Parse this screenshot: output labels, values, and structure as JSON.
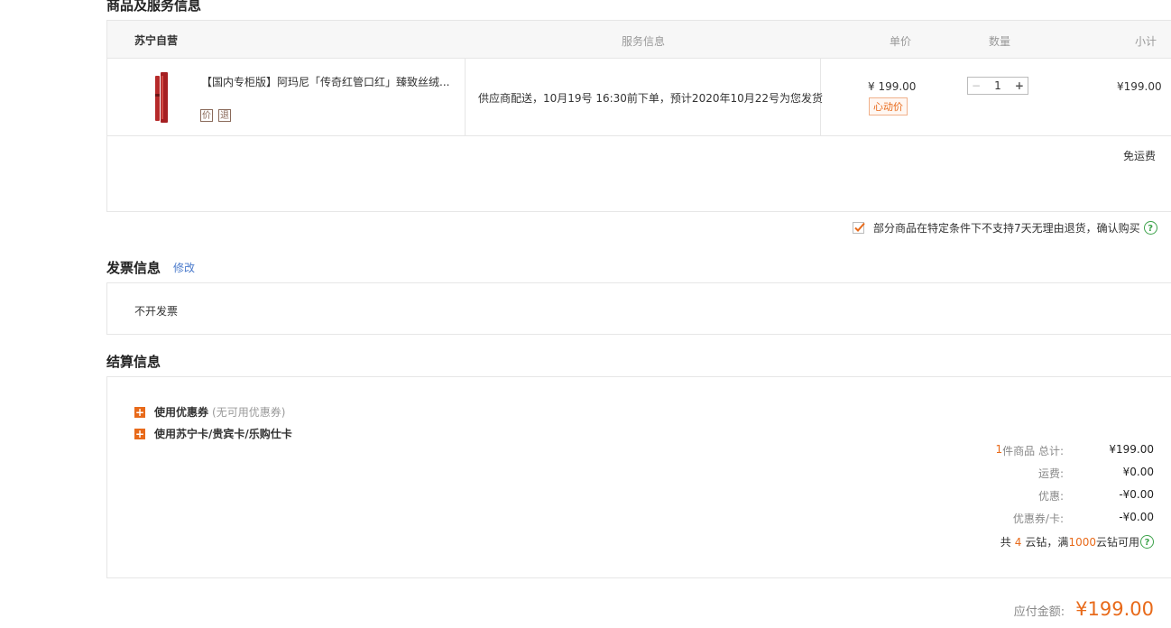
{
  "goods_section": {
    "title": "商品及服务信息",
    "header": {
      "store": "苏宁自营",
      "service": "服务信息",
      "unit_price": "单价",
      "quantity": "数量",
      "subtotal": "小计"
    },
    "item": {
      "name": "【国内专柜版】阿玛尼「传奇红管口红」臻致丝绒...",
      "badge1": "价",
      "badge2": "退",
      "service_text": "供应商配送，10月19号 16:30前下单，预计2020年10月22号为您发货",
      "unit_price": "¥ 199.00",
      "price_tag": "心动价",
      "qty_minus": "−",
      "qty_value": "1",
      "qty_plus": "+",
      "subtotal": "¥199.00"
    },
    "shipping": "免运费",
    "return_notice": "部分商品在特定条件下不支持7天无理由退货，确认购买",
    "help_glyph": "?"
  },
  "invoice_section": {
    "title": "发票信息",
    "edit_link": "修改",
    "value": "不开发票"
  },
  "settlement_section": {
    "title": "结算信息",
    "coupon_label": "使用优惠券",
    "coupon_note": "(无可用优惠券)",
    "card_label": "使用苏宁卡/贵宾卡/乐购仕卡",
    "plus_glyph": "+",
    "count": "1",
    "count_label": "件商品 总计:",
    "total": "¥199.00",
    "freight_label": "运费:",
    "freight": "¥0.00",
    "discount_label": "优惠:",
    "discount": "-¥0.00",
    "coupon_card_label": "优惠券/卡:",
    "coupon_card": "-¥0.00",
    "diamond_prefix": "共",
    "diamond_count": "4",
    "diamond_mid": "云钻，满",
    "diamond_threshold": "1000",
    "diamond_suffix": "云钻可用"
  },
  "payable": {
    "label": "应付金额:",
    "amount": "¥199.00"
  },
  "colors": {
    "accent": "#e86a1a",
    "link": "#4a7acb",
    "help": "#3ca24a"
  }
}
